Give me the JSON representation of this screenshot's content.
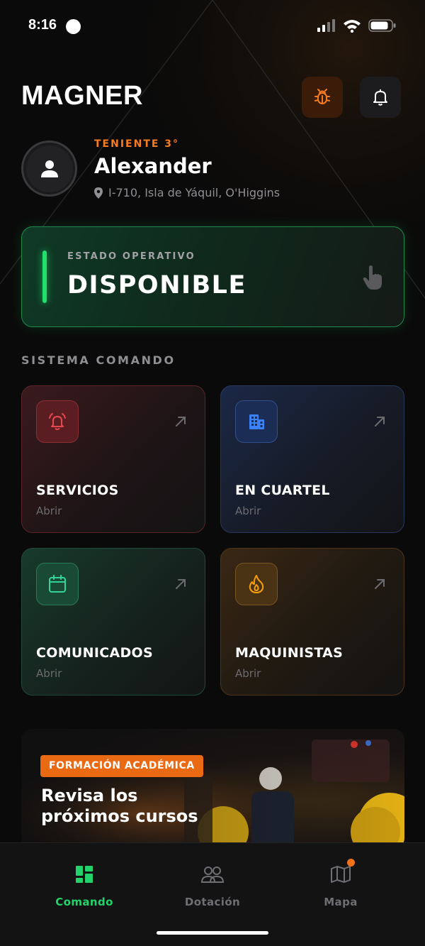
{
  "status_bar": {
    "time": "8:16"
  },
  "header": {
    "brand": "MAGNER"
  },
  "profile": {
    "rank": "TENIENTE 3°",
    "name": "Alexander",
    "location": "I-710, Isla de Yáquil, O'Higgins"
  },
  "operational_status": {
    "label": "ESTADO OPERATIVO",
    "value": "DISPONIBLE",
    "accent_color": "#22e06b"
  },
  "section": {
    "title": "SISTEMA COMANDO"
  },
  "tiles": [
    {
      "title": "SERVICIOS",
      "subtitle": "Abrir",
      "icon": "alarm-bell-icon",
      "color": "#e5484d"
    },
    {
      "title": "EN CUARTEL",
      "subtitle": "Abrir",
      "icon": "building-icon",
      "color": "#3b82f6"
    },
    {
      "title": "COMUNICADOS",
      "subtitle": "Abrir",
      "icon": "calendar-icon",
      "color": "#34d399"
    },
    {
      "title": "MAQUINISTAS",
      "subtitle": "Abrir",
      "icon": "flame-icon",
      "color": "#f59e0b"
    }
  ],
  "banner": {
    "tag": "FORMACIÓN ACADÉMICA",
    "title": "Revisa los próximos cursos"
  },
  "bottom_nav": {
    "items": [
      {
        "label": "Comando",
        "icon": "dashboard-icon",
        "active": true
      },
      {
        "label": "Dotación",
        "icon": "users-icon",
        "active": false
      },
      {
        "label": "Mapa",
        "icon": "map-icon",
        "active": false,
        "badge": true
      }
    ],
    "active_color": "#22d36b"
  }
}
